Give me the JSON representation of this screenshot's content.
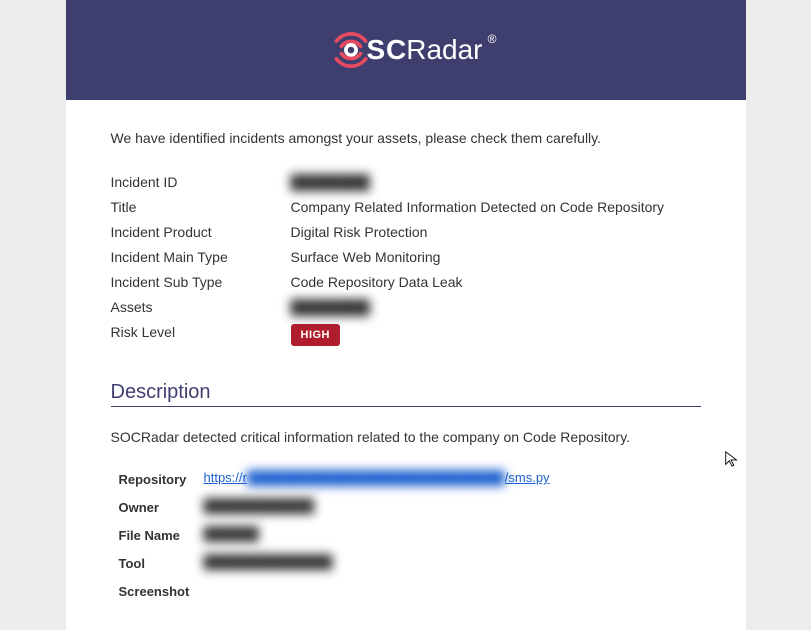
{
  "logo": {
    "prefix": "S",
    "middle": "C",
    "suffix": "Radar",
    "registered": "®"
  },
  "intro": "We have identified incidents amongst your assets, please check them carefully.",
  "incident": {
    "id_label": "Incident ID",
    "id_value": "████████",
    "title_label": "Title",
    "title_value": "Company Related Information Detected on Code Repository",
    "product_label": "Incident Product",
    "product_value": "Digital Risk Protection",
    "main_type_label": "Incident Main Type",
    "main_type_value": "Surface Web Monitoring",
    "sub_type_label": "Incident Sub Type",
    "sub_type_value": "Code Repository Data Leak",
    "assets_label": "Assets",
    "assets_value": "████████",
    "risk_label": "Risk Level",
    "risk_value": "HIGH"
  },
  "description": {
    "heading": "Description",
    "text": "SOCRadar detected critical information related to the company on Code Repository.",
    "repo_label": "Repository",
    "repo_prefix": "https://r",
    "repo_mid": "████████████████████████████",
    "repo_suffix": "/sms.py",
    "owner_label": "Owner",
    "owner_value": "████████████",
    "filename_label": "File Name",
    "filename_value": "██████",
    "tool_label": "Tool",
    "tool_value": "██████████████",
    "screenshot_label": "Screenshot"
  }
}
